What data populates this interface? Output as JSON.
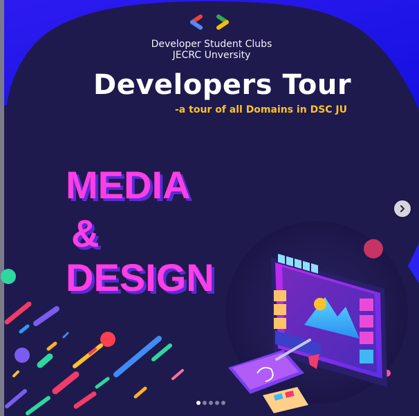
{
  "header": {
    "club_name": "Developer Student Clubs",
    "university": "JECRC Unversity",
    "title": "Developers Tour",
    "subtitle": "-a tour of all Domains in DSC JU"
  },
  "headline": {
    "line1": "MEDIA",
    "line2": "&",
    "line3": "DESIGN"
  },
  "carousel": {
    "slide_count": 5,
    "active_index": 0,
    "next_icon": "chevron-right-icon"
  },
  "colors": {
    "background": "#1e1a4d",
    "wave": "#1f1cf2",
    "headline": "#ff3fe6",
    "subtitle": "#ffc12b",
    "logo_blue": "#4f8bf5",
    "logo_red": "#ea4335",
    "logo_green": "#34a853",
    "logo_yellow": "#fbbc04"
  }
}
